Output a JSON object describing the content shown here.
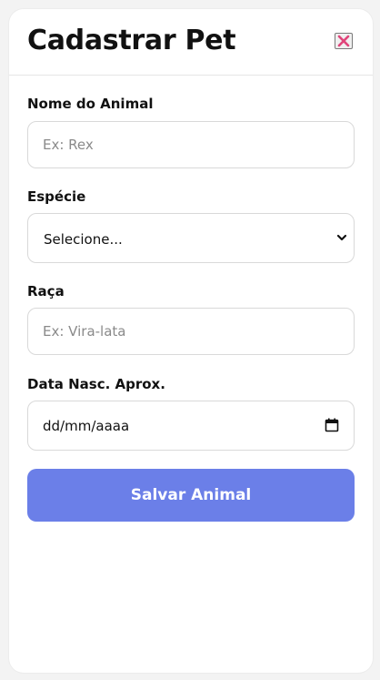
{
  "modal": {
    "title": "Cadastrar Pet",
    "close_icon": "close-x-icon"
  },
  "form": {
    "name": {
      "label": "Nome do Animal",
      "placeholder": "Ex: Rex",
      "value": ""
    },
    "species": {
      "label": "Espécie",
      "selected": "Selecione...",
      "icon": "chevron-down-icon"
    },
    "breed": {
      "label": "Raça",
      "placeholder": "Ex: Vira-lata",
      "value": ""
    },
    "birthdate": {
      "label": "Data Nasc. Aprox.",
      "value": "dd/mm/aaaa",
      "icon": "calendar-icon"
    },
    "submit_label": "Salvar Animal"
  },
  "colors": {
    "accent": "#6b7fe8",
    "close_icon": "#e0457b"
  }
}
